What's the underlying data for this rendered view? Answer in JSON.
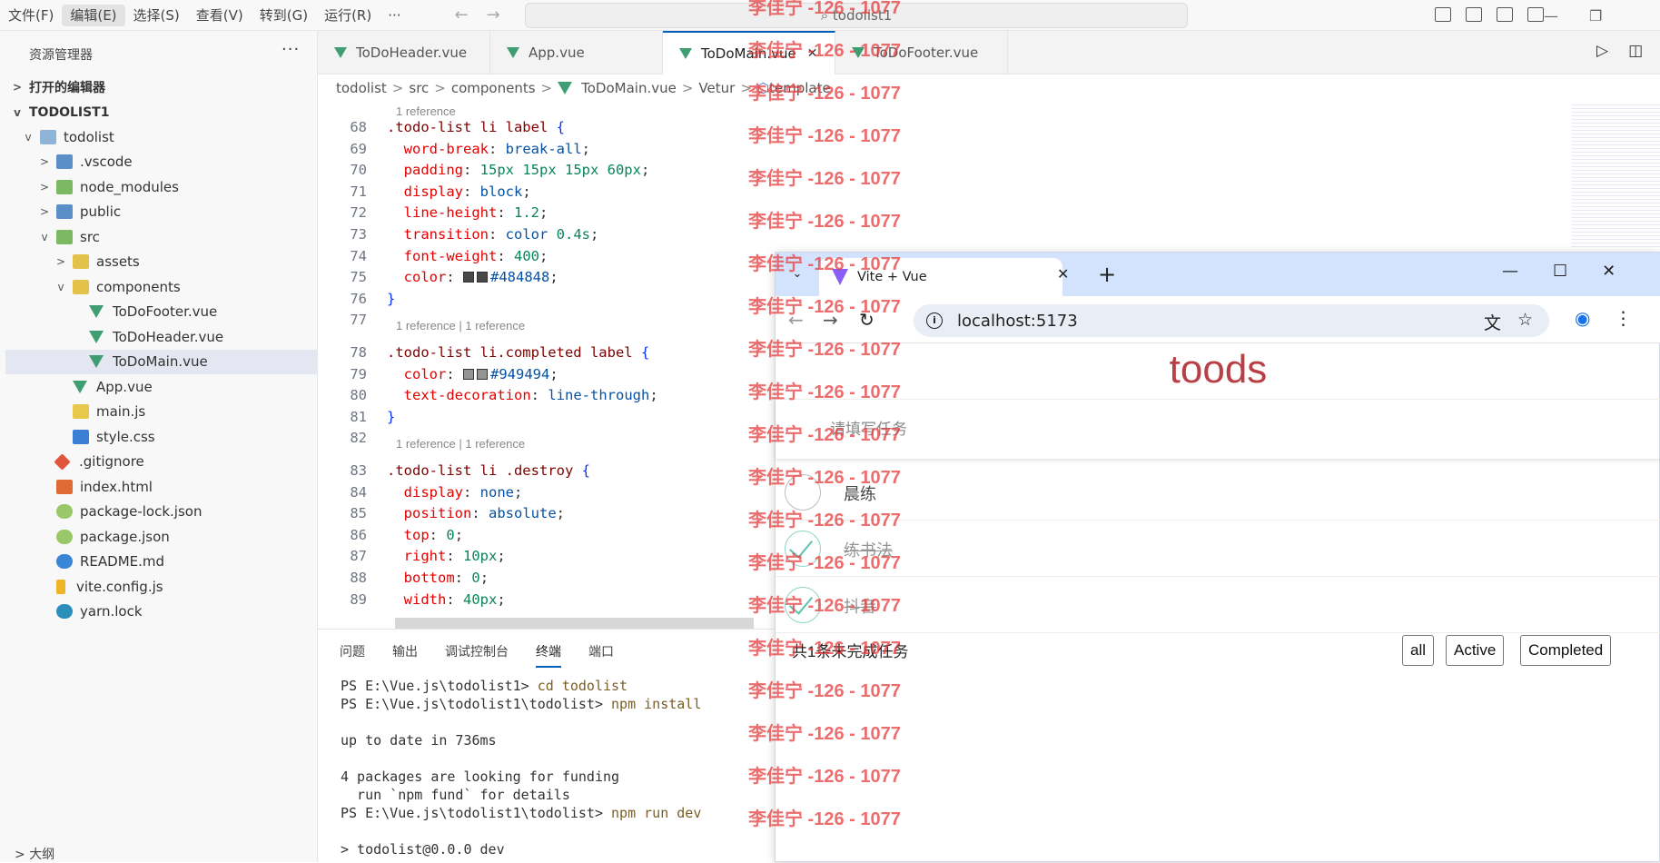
{
  "menubar": {
    "items": [
      "文件(F)",
      "编辑(E)",
      "选择(S)",
      "查看(V)",
      "转到(G)",
      "运行(R)",
      "···"
    ],
    "search": "todolist1"
  },
  "sidebar": {
    "title": "资源管理器",
    "more": "···",
    "open_editors": "打开的编辑器",
    "root": "TODOLIST1",
    "tree": [
      {
        "label": "todolist",
        "indent": 1,
        "chev": "v",
        "icon": "folder"
      },
      {
        "label": ".vscode",
        "indent": 2,
        "chev": ">",
        "icon": "folder-v"
      },
      {
        "label": "node_modules",
        "indent": 2,
        "chev": ">",
        "icon": "folder-g"
      },
      {
        "label": "public",
        "indent": 2,
        "chev": ">",
        "icon": "folder-v"
      },
      {
        "label": "src",
        "indent": 2,
        "chev": "v",
        "icon": "folder-g"
      },
      {
        "label": "assets",
        "indent": 3,
        "chev": ">",
        "icon": "folder-y"
      },
      {
        "label": "components",
        "indent": 3,
        "chev": "v",
        "icon": "folder-y"
      },
      {
        "label": "ToDoFooter.vue",
        "indent": 4,
        "chev": "",
        "icon": "vue"
      },
      {
        "label": "ToDoHeader.vue",
        "indent": 4,
        "chev": "",
        "icon": "vue"
      },
      {
        "label": "ToDoMain.vue",
        "indent": 4,
        "chev": "",
        "icon": "vue",
        "selected": true
      },
      {
        "label": "App.vue",
        "indent": 3,
        "chev": "",
        "icon": "vue"
      },
      {
        "label": "main.js",
        "indent": 3,
        "chev": "",
        "icon": "js"
      },
      {
        "label": "style.css",
        "indent": 3,
        "chev": "",
        "icon": "css"
      },
      {
        "label": ".gitignore",
        "indent": 2,
        "chev": "",
        "icon": "git"
      },
      {
        "label": "index.html",
        "indent": 2,
        "chev": "",
        "icon": "html"
      },
      {
        "label": "package-lock.json",
        "indent": 2,
        "chev": "",
        "icon": "json"
      },
      {
        "label": "package.json",
        "indent": 2,
        "chev": "",
        "icon": "json"
      },
      {
        "label": "README.md",
        "indent": 2,
        "chev": "",
        "icon": "info"
      },
      {
        "label": "vite.config.js",
        "indent": 2,
        "chev": "",
        "icon": "bolt"
      },
      {
        "label": "yarn.lock",
        "indent": 2,
        "chev": "",
        "icon": "yarn"
      }
    ],
    "outline": "大纲"
  },
  "tabs": [
    {
      "label": "ToDoHeader.vue",
      "active": false
    },
    {
      "label": "App.vue",
      "active": false
    },
    {
      "label": "ToDoMain.vue",
      "active": true
    },
    {
      "label": "ToDoFooter.vue",
      "active": false
    }
  ],
  "breadcrumb": [
    "todolist",
    "src",
    "components",
    "ToDoMain.vue",
    "Vetur",
    "template"
  ],
  "code": {
    "refs": [
      "1 reference",
      "1 reference | 1 reference",
      "1 reference | 1 reference"
    ],
    "lines": [
      {
        "n": "68",
        "sel": ".todo-list li label",
        "open": " {"
      },
      {
        "n": "69",
        "prop": "word-break",
        "val": "break-all"
      },
      {
        "n": "70",
        "prop": "padding",
        "num": "15px 15px 15px 60px"
      },
      {
        "n": "71",
        "prop": "display",
        "val": "block"
      },
      {
        "n": "72",
        "prop": "line-height",
        "num": "1.2"
      },
      {
        "n": "73",
        "prop": "transition",
        "val": "color",
        "num": "0.4s"
      },
      {
        "n": "74",
        "prop": "font-weight",
        "num": "400"
      },
      {
        "n": "75",
        "prop": "color",
        "swatch": "#484848",
        "val": "#484848"
      },
      {
        "n": "76",
        "close": "}"
      },
      {
        "n": "77"
      },
      {
        "n": "78",
        "sel": ".todo-list li.completed label",
        "open": " {"
      },
      {
        "n": "79",
        "prop": "color",
        "swatch": "#949494",
        "val": "#949494"
      },
      {
        "n": "80",
        "prop": "text-decoration",
        "val": "line-through"
      },
      {
        "n": "81",
        "close": "}"
      },
      {
        "n": "82"
      },
      {
        "n": "83",
        "sel": ".todo-list li .destroy",
        "open": " {"
      },
      {
        "n": "84",
        "prop": "display",
        "val": "none"
      },
      {
        "n": "85",
        "prop": "position",
        "val": "absolute"
      },
      {
        "n": "86",
        "prop": "top",
        "num": "0"
      },
      {
        "n": "87",
        "prop": "right",
        "num": "10px"
      },
      {
        "n": "88",
        "prop": "bottom",
        "num": "0"
      },
      {
        "n": "89",
        "prop": "width",
        "num": "40px"
      }
    ]
  },
  "panel": {
    "tabs": [
      "问题",
      "输出",
      "调试控制台",
      "终端",
      "端口"
    ],
    "active_tab": "终端",
    "terminal": [
      {
        "prompt": "PS E:\\Vue.js\\todolist1> ",
        "cmd": "cd todolist"
      },
      {
        "prompt": "PS E:\\Vue.js\\todolist1\\todolist> ",
        "cmd": "npm install"
      },
      {
        "prompt": "",
        "cmd": ""
      },
      {
        "prompt": "up to date in 736ms",
        "cmd": ""
      },
      {
        "prompt": "",
        "cmd": ""
      },
      {
        "prompt": "4 packages are looking for funding",
        "cmd": ""
      },
      {
        "prompt": "  run `npm fund` for details",
        "cmd": ""
      },
      {
        "prompt": "PS E:\\Vue.js\\todolist1\\todolist> ",
        "cmd": "npm run dev"
      },
      {
        "prompt": "",
        "cmd": ""
      },
      {
        "prompt": "> todolist@0.0.0 dev",
        "cmd": ""
      }
    ]
  },
  "browser": {
    "tab_title": "Vite + Vue",
    "url": "localhost:5173",
    "app": {
      "title": "toods",
      "placeholder": "请填写任务",
      "todos": [
        {
          "label": "晨练",
          "done": false
        },
        {
          "label": "练书法",
          "done": true
        },
        {
          "label": "抖音",
          "done": true
        }
      ],
      "count_text": "共1条未完成任务",
      "filters": [
        "all",
        "Active",
        "Completed"
      ]
    }
  },
  "watermark": "李佳宁 -126 - 1077",
  "colors": {
    "accent": "#005fb8",
    "todo_title": "#b83f45",
    "watermark": "#e63c3c"
  }
}
